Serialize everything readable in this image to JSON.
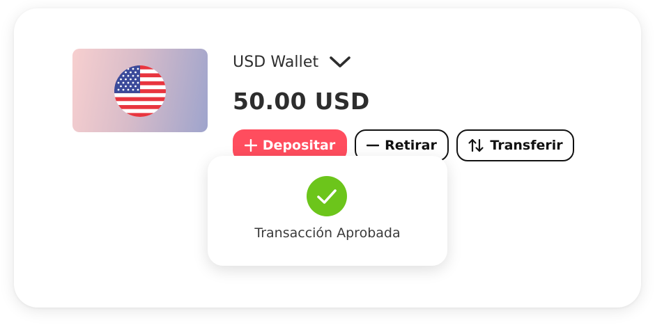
{
  "wallet": {
    "name": "USD Wallet",
    "currency_flag_icon": "us-flag-icon",
    "selector_icon": "chevron-down-icon",
    "balance": "50.00 USD"
  },
  "actions": {
    "deposit_label": "Depositar",
    "withdraw_label": "Retirar",
    "transfer_label": "Transferir"
  },
  "toast": {
    "icon": "check-icon",
    "message": "Transacción Aprobada"
  },
  "colors": {
    "deposit_button": "#ff4d5e",
    "success": "#6cc51b",
    "text_dark": "#2d2d2d"
  }
}
